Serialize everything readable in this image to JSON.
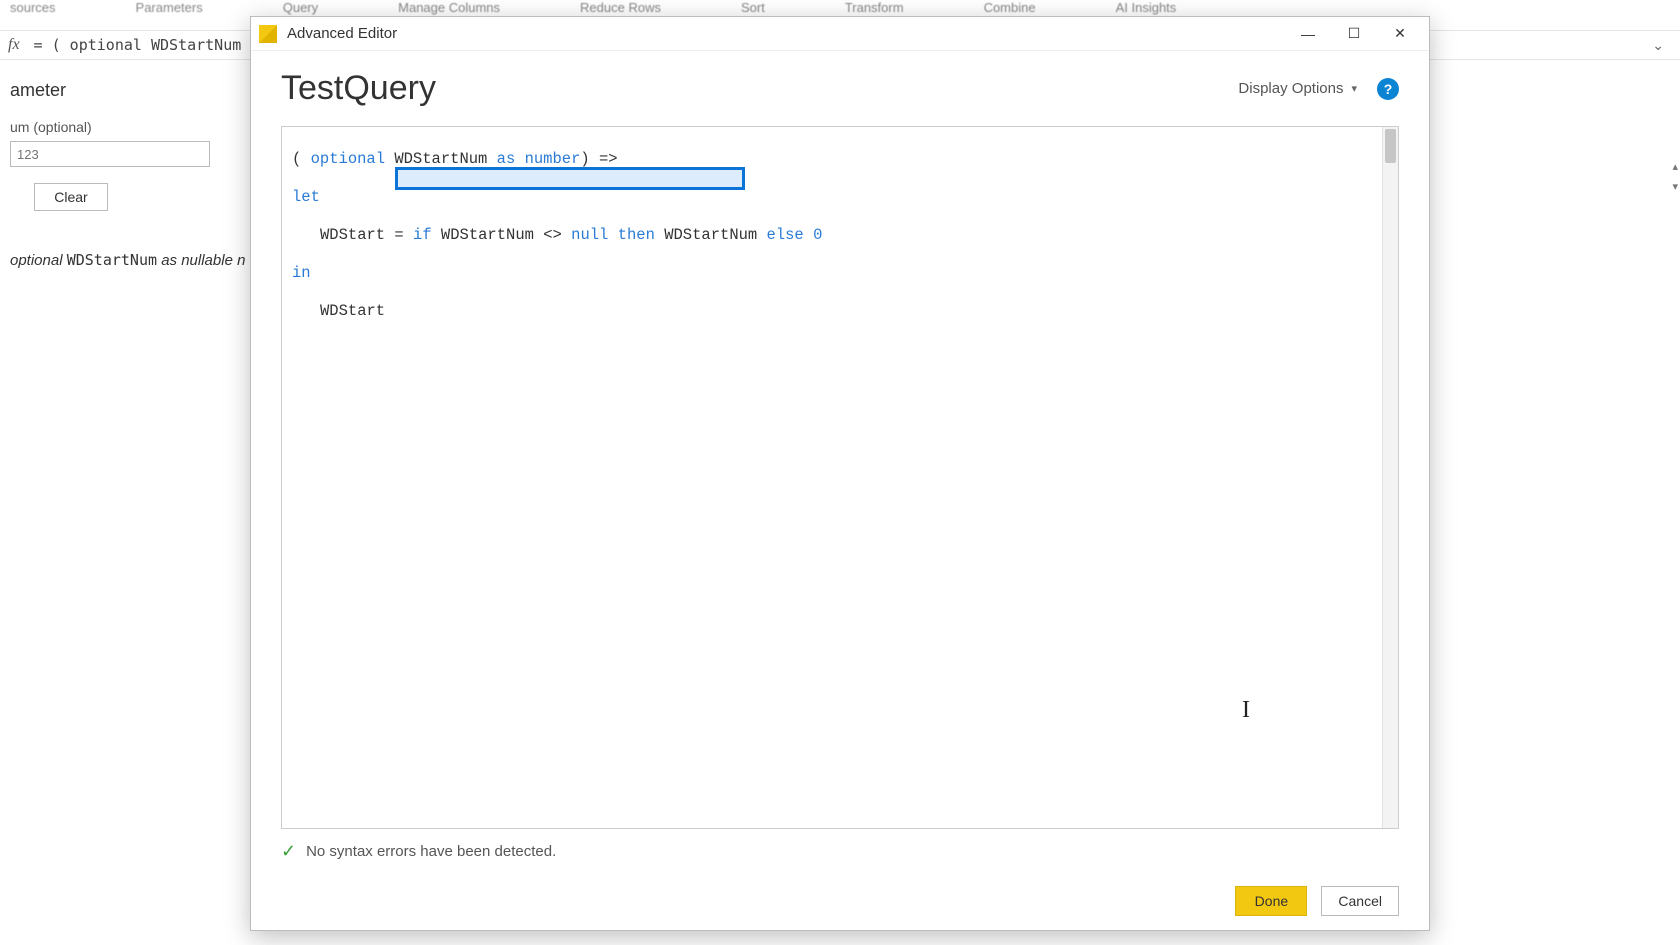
{
  "ribbon": {
    "items": [
      "sources",
      "Parameters",
      "Query",
      "Manage Columns",
      "Reduce Rows",
      "Sort",
      "Transform",
      "Combine",
      "AI Insights"
    ]
  },
  "formula_bar": {
    "prefix": "fx",
    "content": "= ( optional WDStartNum a"
  },
  "left_panel": {
    "heading": "ameter",
    "field_label": "um (optional)",
    "field_placeholder": "123",
    "clear_label": "Clear",
    "type_line_prefix": "optional ",
    "type_line_code": "WDStartNum",
    "type_line_suffix": " as nullable n"
  },
  "dialog": {
    "title": "Advanced Editor",
    "query_name": "TestQuery",
    "display_options": "Display Options",
    "help_glyph": "?",
    "code": {
      "l1_open": "( ",
      "l1_kw_optional": "optional",
      "l1_ident": " WDStartNum ",
      "l1_kw_as": "as",
      "l1_sp": " ",
      "l1_type": "number",
      "l1_close": ") =>",
      "l2_let": "let",
      "l3_lhs": "WDStart = ",
      "l3_if": "if",
      "l3_a": " WDStartNum <> ",
      "l3_null": "null",
      "l3_sp1": " ",
      "l3_then": "then",
      "l3_b": " WDStartNum ",
      "l3_else": "else",
      "l3_sp2": " ",
      "l3_zero": "0",
      "l4_in": "in",
      "l5_out": "WDStart"
    },
    "status": "No syntax errors have been detected.",
    "done_label": "Done",
    "cancel_label": "Cancel"
  }
}
